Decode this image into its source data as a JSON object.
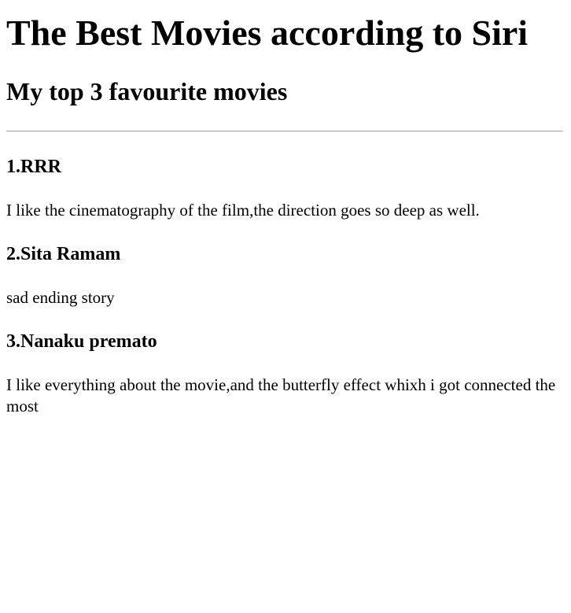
{
  "page": {
    "title": "The Best Movies according to Siri",
    "subtitle": "My top 3 favourite movies"
  },
  "movies": [
    {
      "heading": "1.RRR",
      "description": "I like the cinematography of the film,the direction goes so deep as well."
    },
    {
      "heading": "2.Sita Ramam",
      "description": "sad ending story"
    },
    {
      "heading": "3.Nanaku premato",
      "description": "I like everything about the movie,and the butterfly effect whixh i got connected the most"
    }
  ]
}
